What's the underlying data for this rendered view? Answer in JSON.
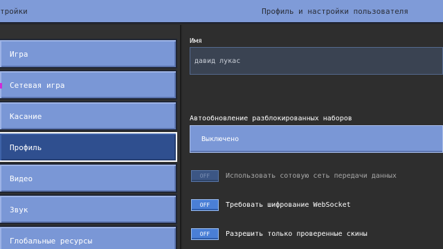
{
  "header": {
    "left_title": "тройки",
    "right_title": "Профиль и настройки пользователя"
  },
  "sidebar": {
    "items": [
      {
        "label": "Игра",
        "active": false
      },
      {
        "label": "Сетевая игра",
        "active": false
      },
      {
        "label": "Касание",
        "active": false
      },
      {
        "label": "Профиль",
        "active": true
      },
      {
        "label": "Видео",
        "active": false
      },
      {
        "label": "Звук",
        "active": false
      },
      {
        "label": "Глобальные ресурсы",
        "active": false
      }
    ]
  },
  "profile": {
    "name_label": "Имя",
    "name_value": "давид лукас",
    "autoupdate_label": "Автообновление разблокированных наборов",
    "autoupdate_value": "Выключено",
    "toggles": [
      {
        "state": "OFF",
        "label": "Использовать сотовую сеть передачи данных",
        "enabled": false
      },
      {
        "state": "OFF",
        "label": "Требовать шифрование WebSocket",
        "enabled": true
      },
      {
        "state": "OFF",
        "label": "Разрешить только проверенные скины",
        "enabled": true
      }
    ]
  },
  "colors": {
    "accent": "#7a97d6",
    "active_tab": "#2f4f8f",
    "toggle_blue": "#4a7fd6",
    "background": "#2e2e2e"
  }
}
